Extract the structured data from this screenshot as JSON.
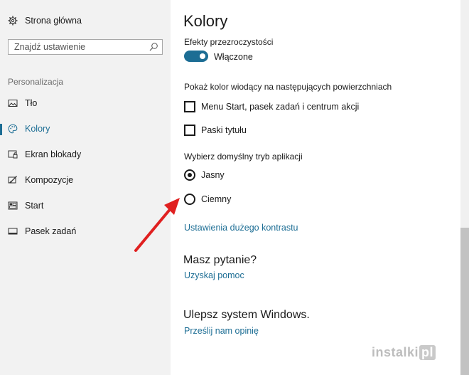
{
  "sidebar": {
    "home_label": "Strona główna",
    "search_placeholder": "Znajdź ustawienie",
    "section_label": "Personalizacja",
    "items": [
      {
        "label": "Tło",
        "icon": "picture-icon"
      },
      {
        "label": "Kolory",
        "icon": "palette-icon",
        "active": true
      },
      {
        "label": "Ekran blokady",
        "icon": "lock-screen-icon"
      },
      {
        "label": "Kompozycje",
        "icon": "themes-icon"
      },
      {
        "label": "Start",
        "icon": "start-icon"
      },
      {
        "label": "Pasek zadań",
        "icon": "taskbar-icon"
      }
    ]
  },
  "main": {
    "title": "Kolory",
    "transparency_label": "Efekty przezroczystości",
    "transparency_toggle_text": "Włączone",
    "surfaces_label": "Pokaż kolor wiodący na następujących powierzchniach",
    "checkboxes": [
      {
        "label": "Menu Start, pasek zadań i centrum akcji",
        "checked": false
      },
      {
        "label": "Paski tytułu",
        "checked": false
      }
    ],
    "app_mode_label": "Wybierz domyślny tryb aplikacji",
    "radios": [
      {
        "label": "Jasny",
        "selected": true
      },
      {
        "label": "Ciemny",
        "selected": false
      }
    ],
    "high_contrast_link": "Ustawienia dużego kontrastu",
    "question_heading": "Masz pytanie?",
    "help_link": "Uzyskaj pomoc",
    "improve_heading": "Ulepsz system Windows.",
    "feedback_link": "Prześlij nam opinię"
  },
  "watermark": {
    "part1": "instalki",
    "part2": "pl"
  },
  "colors": {
    "accent": "#1c6d94",
    "arrow": "#e02020",
    "sidebar_bg": "#f2f2f2"
  }
}
